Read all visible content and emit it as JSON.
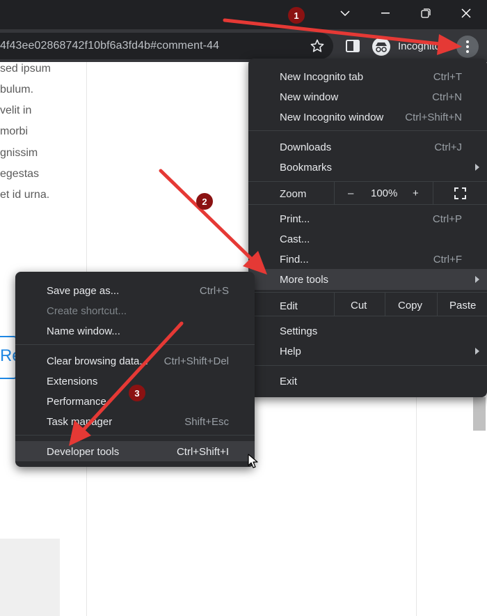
{
  "browser": {
    "url": "4f43ee02868742f10bf6a3fd4b#comment-44",
    "profile_label": "Incognito"
  },
  "page_content": {
    "lines": [
      "sed ipsum",
      "bulum.",
      "velit in",
      "morbi",
      "gnissim",
      "egestas",
      "et id urna."
    ],
    "button_fragment": "Re"
  },
  "main_menu": {
    "new_incognito_tab": {
      "label": "New Incognito tab",
      "shortcut": "Ctrl+T"
    },
    "new_window": {
      "label": "New window",
      "shortcut": "Ctrl+N"
    },
    "new_incognito_window": {
      "label": "New Incognito window",
      "shortcut": "Ctrl+Shift+N"
    },
    "downloads": {
      "label": "Downloads",
      "shortcut": "Ctrl+J"
    },
    "bookmarks": {
      "label": "Bookmarks"
    },
    "zoom": {
      "label": "Zoom",
      "minus": "–",
      "value": "100%",
      "plus": "+"
    },
    "print": {
      "label": "Print...",
      "shortcut": "Ctrl+P"
    },
    "cast": {
      "label": "Cast..."
    },
    "find": {
      "label": "Find...",
      "shortcut": "Ctrl+F"
    },
    "more_tools": {
      "label": "More tools"
    },
    "edit": {
      "label": "Edit",
      "cut": "Cut",
      "copy": "Copy",
      "paste": "Paste"
    },
    "settings": {
      "label": "Settings"
    },
    "help": {
      "label": "Help"
    },
    "exit": {
      "label": "Exit"
    }
  },
  "submenu": {
    "save_page": {
      "label": "Save page as...",
      "shortcut": "Ctrl+S"
    },
    "create_shortcut": {
      "label": "Create shortcut..."
    },
    "name_window": {
      "label": "Name window..."
    },
    "clear_browsing": {
      "label": "Clear browsing data...",
      "shortcut": "Ctrl+Shift+Del"
    },
    "extensions": {
      "label": "Extensions"
    },
    "performance": {
      "label": "Performance"
    },
    "task_manager": {
      "label": "Task manager",
      "shortcut": "Shift+Esc"
    },
    "developer_tools": {
      "label": "Developer tools",
      "shortcut": "Ctrl+Shift+I"
    }
  },
  "annotations": {
    "steps": [
      "1",
      "2",
      "3"
    ],
    "arrow_color": "#e53935",
    "badge_color": "#8b1212"
  },
  "icons": [
    "chevron-down-icon",
    "minimize-icon",
    "restore-icon",
    "close-icon",
    "star-icon",
    "sidepanel-icon",
    "incognito-icon",
    "kebab-menu-icon",
    "fullscreen-icon",
    "submenu-arrow-icon",
    "mouse-cursor-icon"
  ]
}
